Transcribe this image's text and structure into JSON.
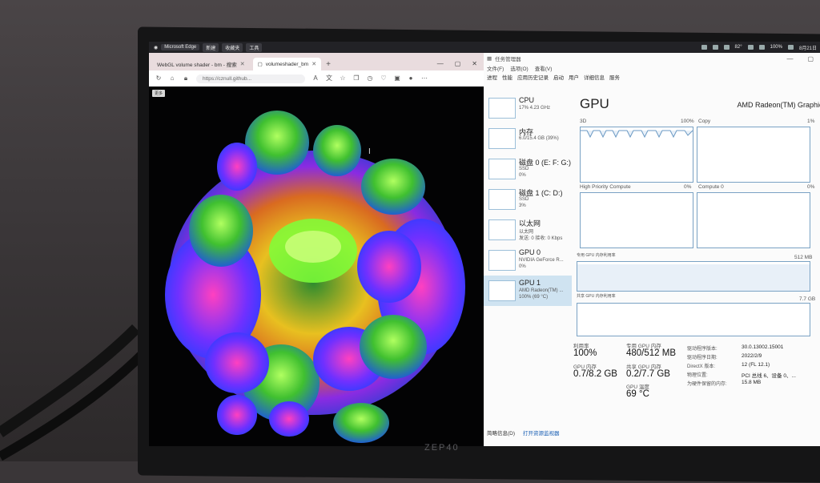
{
  "topbar": {
    "app": "Microsoft Edge",
    "tabs": [
      "新建",
      "收藏夹",
      "工具"
    ],
    "tray": {
      "battery": "100%",
      "date": "8月21日",
      "temp": "82°"
    }
  },
  "browser": {
    "tabs": [
      {
        "label": "WebGL volume shader - bm - 搜索"
      },
      {
        "label": "volumeshader_bm"
      }
    ],
    "url": "https://cznull.github...",
    "toolbar_pill": "更多"
  },
  "taskmanager": {
    "title": "任务管理器",
    "menu": [
      "文件(F)",
      "选项(O)",
      "查看(V)"
    ],
    "tabs": [
      "进程",
      "性能",
      "应用历史记录",
      "启动",
      "用户",
      "详细信息",
      "服务"
    ],
    "sidebar": [
      {
        "name": "CPU",
        "l1": "17% 4.23 GHz",
        "l2": ""
      },
      {
        "name": "内存",
        "l1": "6.0/15.4 GB (39%)",
        "l2": ""
      },
      {
        "name": "磁盘 0 (E: F: G:)",
        "l1": "SSD",
        "l2": "0%"
      },
      {
        "name": "磁盘 1 (C: D:)",
        "l1": "SSD",
        "l2": "3%"
      },
      {
        "name": "以太网",
        "l1": "以太网",
        "l2": "发送: 0 接收: 0 Kbps"
      },
      {
        "name": "GPU 0",
        "l1": "NVIDIA GeForce R...",
        "l2": "0%"
      },
      {
        "name": "GPU 1",
        "l1": "AMD Radeon(TM) ...",
        "l2": "100% (69 °C)"
      }
    ],
    "gpu": {
      "title": "GPU",
      "model": "AMD Radeon(TM) Graphics",
      "graphs": {
        "g3d": {
          "label": "3D",
          "pct": "100%"
        },
        "copy": {
          "label": "Copy",
          "pct": "1%"
        },
        "hpc": {
          "label": "High Priority Compute",
          "pct": "0%"
        },
        "c0": {
          "label": "Compute 0",
          "pct": "0%"
        },
        "ded": {
          "label": "专用 GPU 内存利用率",
          "max": "512 MB"
        },
        "shr": {
          "label": "共享 GPU 内存利用率",
          "max": "7.7 GB"
        }
      },
      "stats": {
        "util_l": "利用率",
        "util_v": "100%",
        "ded_l": "专用 GPU 内存",
        "ded_v": "480/512 MB",
        "gmem_l": "GPU 内存",
        "gmem_v": "0.7/8.2 GB",
        "shr_l": "共享 GPU 内存",
        "shr_v": "0.2/7.7 GB",
        "temp_l": "GPU 温度",
        "temp_v": "69 °C"
      },
      "info": [
        {
          "k": "驱动程序版本:",
          "v": "30.0.13002.15001"
        },
        {
          "k": "驱动程序日期:",
          "v": "2022/2/9"
        },
        {
          "k": "DirectX 版本:",
          "v": "12 (FL 12.1)"
        },
        {
          "k": "物理位置:",
          "v": "PCI 总线 6、设备 0、..."
        },
        {
          "k": "为硬件保留的内存:",
          "v": "15.8 MB"
        }
      ]
    },
    "footer": {
      "summary": "简略信息(D)",
      "monitor": "打开资源监视器"
    }
  },
  "colors": {
    "accent": "#1a5fb4",
    "graph_line": "#7aa2c4",
    "selected": "#cfe3f1"
  }
}
